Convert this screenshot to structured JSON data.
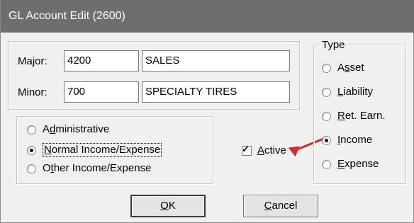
{
  "window": {
    "title": "GL Account Edit (2600)"
  },
  "account": {
    "major_label": "Major:",
    "major_code": "4200",
    "major_name": "SALES",
    "minor_label": "Minor:",
    "minor_code": "700",
    "minor_name": "SPECIALTY TIRES"
  },
  "category": {
    "options": [
      {
        "pre": "A",
        "ul": "d",
        "post": "ministrative",
        "selected": false
      },
      {
        "pre": "",
        "ul": "N",
        "post": "ormal Income/Expense",
        "selected": true
      },
      {
        "pre": "O",
        "ul": "t",
        "post": "her Income/Expense",
        "selected": false
      }
    ]
  },
  "active": {
    "pre": "",
    "ul": "A",
    "post": "ctive",
    "checked": true,
    "check_mark": "✓"
  },
  "type_group": {
    "caption": "Type",
    "options": [
      {
        "pre": "A",
        "ul": "s",
        "post": "set",
        "selected": false
      },
      {
        "pre": "",
        "ul": "L",
        "post": "iability",
        "selected": false
      },
      {
        "pre": "",
        "ul": "R",
        "post": "et. Earn.",
        "selected": false
      },
      {
        "pre": "",
        "ul": "I",
        "post": "ncome",
        "selected": true
      },
      {
        "pre": "",
        "ul": "E",
        "post": "xpense",
        "selected": false
      }
    ]
  },
  "buttons": {
    "ok": {
      "pre": "",
      "ul": "O",
      "post": "K"
    },
    "cancel": {
      "pre": "",
      "ul": "C",
      "post": "ancel"
    }
  },
  "colors": {
    "titlebar": "#6e6e6e",
    "dialog_bg": "#f0f0f0",
    "annotation_arrow": "#d42a2a"
  }
}
